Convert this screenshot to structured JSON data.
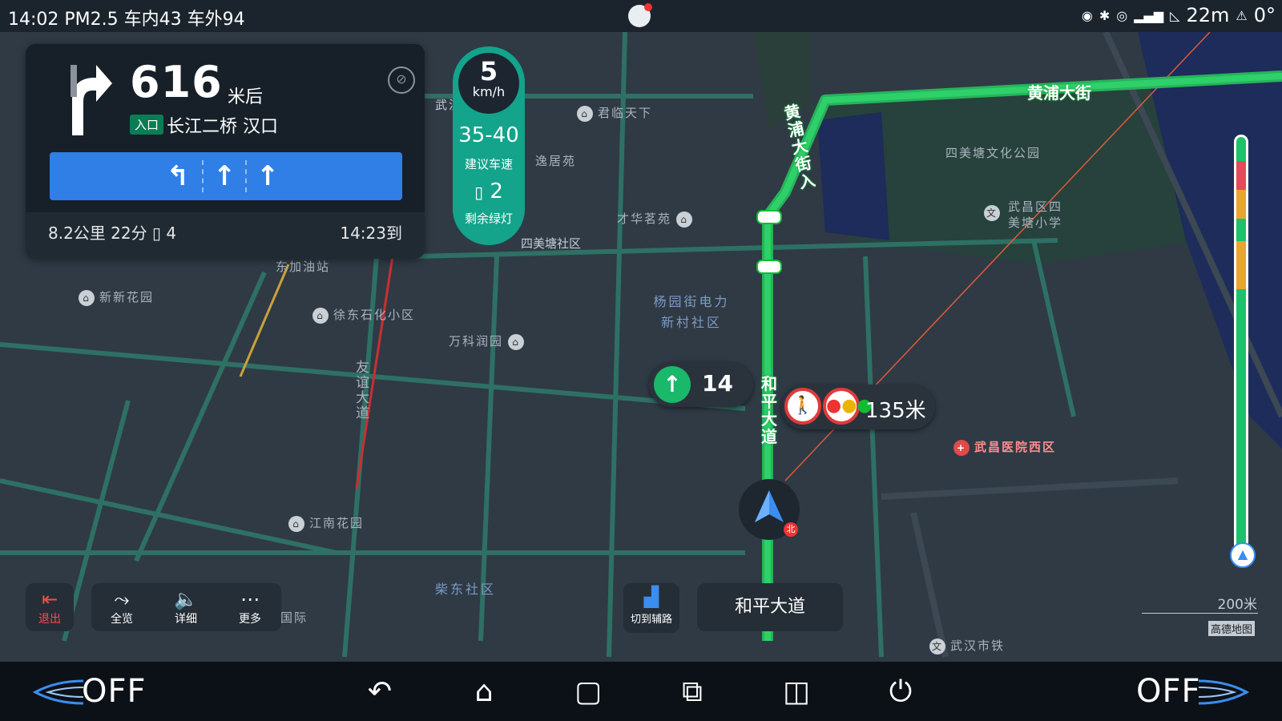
{
  "status_bar": {
    "left_text": "14:02  PM2.5 车内43 车外94",
    "altitude": "22m",
    "angle": "0°"
  },
  "guidance": {
    "turn_icon": "turn-right-arrow-icon",
    "distance": "616",
    "distance_unit": "米后",
    "entry_badge": "入口",
    "road_name": "长江二桥 汉口",
    "lanes": [
      "left-turn-lane-icon",
      "straight-lane-icon",
      "straight-lane-icon"
    ],
    "trip_summary": "8.2公里  22分  ▯ 4",
    "eta": "14:23到"
  },
  "speed": {
    "current": "5",
    "unit": "km/h",
    "suggested_range": "35-40",
    "suggested_label": "建议车速",
    "green_lights": "2",
    "green_label": "剩余绿灯"
  },
  "map": {
    "roads": [
      "黄浦大街",
      "黄浦大街入",
      "和平大道",
      "友谊大道"
    ],
    "pois": [
      "君临天下",
      "逸居苑",
      "才华茗苑",
      "四美塘社区",
      "四美塘文化公园",
      "武昌区四美塘小学",
      "东加油站",
      "新新花园",
      "徐东石化小区",
      "万科润园",
      "杨园街电力新村社区",
      "武昌医院西区",
      "江南花园",
      "柴东社区",
      "武汉市铁",
      "国际",
      "武汉"
    ],
    "next_turn_count": "14",
    "light_distance": "135米"
  },
  "controls": {
    "exit": "退出",
    "overview": "全览",
    "detail": "详细",
    "more": "更多",
    "aux_road": "切到辅路",
    "current_road": "和平大道"
  },
  "scale": {
    "label": "200米",
    "brand": "高德地图"
  },
  "navbar": {
    "left_status": "OFF",
    "right_status": "OFF"
  },
  "route_progress": {
    "traveled_fraction": 0.97,
    "segments": [
      "green",
      "red",
      "orange",
      "green",
      "orange",
      "green"
    ]
  }
}
